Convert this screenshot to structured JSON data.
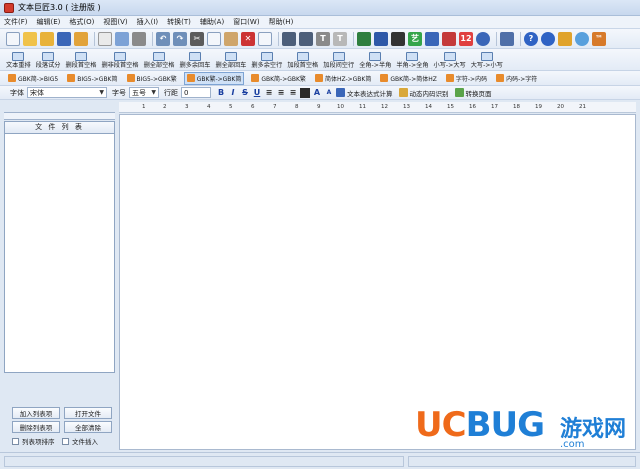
{
  "window": {
    "title": "文本巨匠3.0 ( 注册版 )"
  },
  "menu": [
    {
      "label": "文件(F)"
    },
    {
      "label": "编辑(E)"
    },
    {
      "label": "格式(O)"
    },
    {
      "label": "视图(V)"
    },
    {
      "label": "插入(I)"
    },
    {
      "label": "转换(T)"
    },
    {
      "label": "辅助(A)"
    },
    {
      "label": "窗口(W)"
    },
    {
      "label": "帮助(H)"
    }
  ],
  "toolbar_row2": [
    {
      "label": "文本重排"
    },
    {
      "label": "段落试分"
    },
    {
      "label": "删段首空格"
    },
    {
      "label": "删非段首空格"
    },
    {
      "label": "删全部空格"
    },
    {
      "label": "删多余回车"
    },
    {
      "label": "删全部回车"
    },
    {
      "label": "删多余空行"
    },
    {
      "label": "加段首空格"
    },
    {
      "label": "加段间空行"
    },
    {
      "label": "全角->半角"
    },
    {
      "label": "半角->全角"
    },
    {
      "label": "小写->大写"
    },
    {
      "label": "大写->小写"
    }
  ],
  "toolbar_row3": [
    {
      "label": "GBK简->BIG5"
    },
    {
      "label": "BIG5->GBK简"
    },
    {
      "label": "BIG5->GBK繁"
    },
    {
      "label": "GBK繁->GBK简"
    },
    {
      "label": "GBK简->GBK繁"
    },
    {
      "label": "简体HZ->GBK简"
    },
    {
      "label": "GBK简->简体HZ"
    },
    {
      "label": "字符->内码"
    },
    {
      "label": "内码->字符"
    }
  ],
  "format_bar": {
    "font_label": "字体",
    "font_value": "宋体",
    "size_label": "字号",
    "size_value": "五号",
    "spacing_label": "行距",
    "spacing_value": "0",
    "expr_calc": "文本表达式计算",
    "dynamic_code": "动态内码识别",
    "convert_page": "转换页面"
  },
  "ruler": {
    "ticks": [
      "1",
      "2",
      "3",
      "4",
      "5",
      "6",
      "7",
      "8",
      "9",
      "10",
      "11",
      "12",
      "13",
      "14",
      "15",
      "16",
      "17",
      "18",
      "19",
      "20",
      "21"
    ]
  },
  "sidebar": {
    "list_title": "文 件 列 表",
    "add_list_btn": "加入列表项",
    "open_file_btn": "打开文件",
    "delete_list_btn": "删除列表项",
    "clear_all_btn": "全部清除",
    "sort_check": "列表项排序",
    "insert_check": "文件插入"
  },
  "watermark": {
    "logo_u": "U",
    "logo_c": "C",
    "logo_bug": "BUG",
    "logo_cn": "游戏网",
    "logo_domain": ".com"
  },
  "colors": {
    "accent": "#1f7fd6",
    "brand_orange": "#ef6a1a",
    "chrome_bg": "#dfe8f3"
  }
}
